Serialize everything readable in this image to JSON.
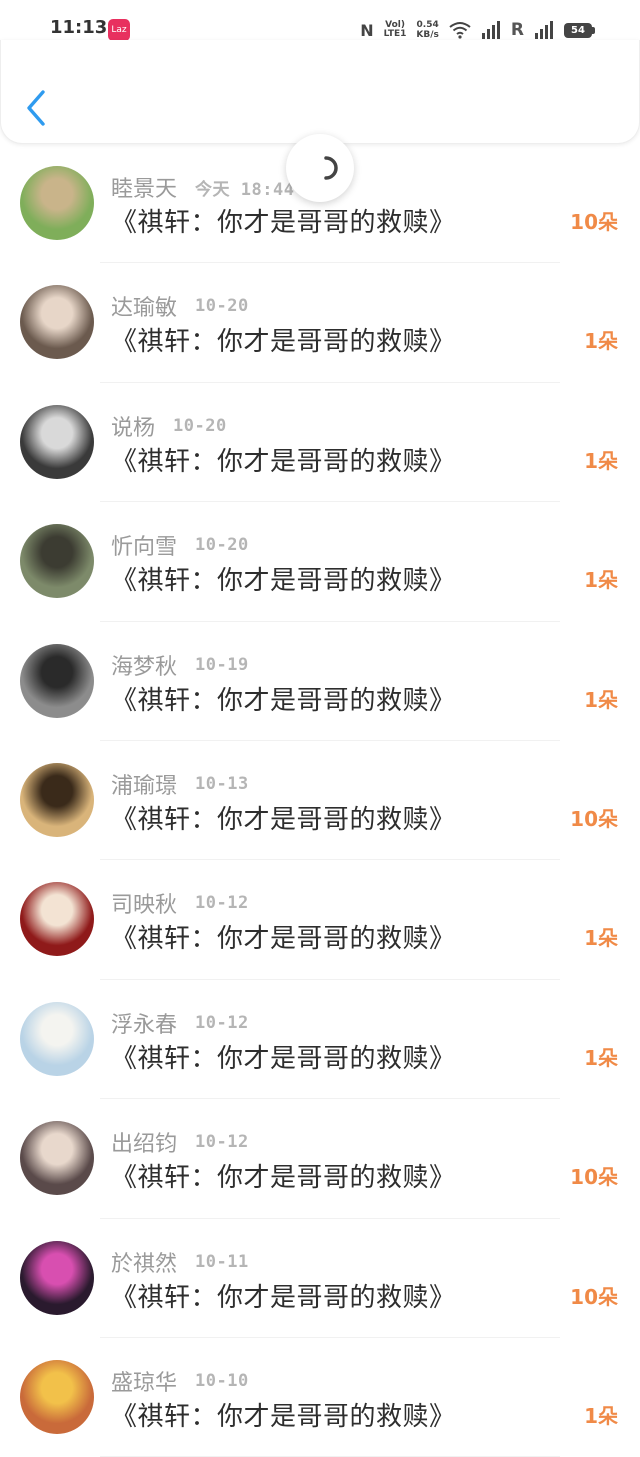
{
  "status_bar": {
    "time": "11:13",
    "app_icon_text": "Laz",
    "nfc": "N",
    "volte_top": "Vol)",
    "volte_bottom": "LTE1",
    "speed_top": "0.54",
    "speed_bottom": "KB/s",
    "roaming": "R",
    "battery": "54"
  },
  "header": {
    "back_icon": "chevron-left-icon"
  },
  "colors": {
    "accent_blue": "#2f9bef",
    "count_orange": "#f08a47",
    "name_gray": "#9a9a9a",
    "date_gray": "#b5b5b5",
    "title_dark": "#2e2e2e"
  },
  "items": [
    {
      "name": "睦景天",
      "date": "今天 18:44",
      "title": "《祺轩：你才是哥哥的救赎》",
      "count": "10朵",
      "avatar_bg": "#7fae5a",
      "avatar_fg": "#c9b48a"
    },
    {
      "name": "达瑜敏",
      "date": "10-20",
      "title": "《祺轩：你才是哥哥的救赎》",
      "count": "1朵",
      "avatar_bg": "#6b5a4e",
      "avatar_fg": "#e7d6c8"
    },
    {
      "name": "说杨",
      "date": "10-20",
      "title": "《祺轩：你才是哥哥的救赎》",
      "count": "1朵",
      "avatar_bg": "#3a3a3a",
      "avatar_fg": "#d9d9d9"
    },
    {
      "name": "忻向雪",
      "date": "10-20",
      "title": "《祺轩：你才是哥哥的救赎》",
      "count": "1朵",
      "avatar_bg": "#7d8a6a",
      "avatar_fg": "#3c3c32"
    },
    {
      "name": "海梦秋",
      "date": "10-19",
      "title": "《祺轩：你才是哥哥的救赎》",
      "count": "1朵",
      "avatar_bg": "#8c8c8c",
      "avatar_fg": "#2a2a2a"
    },
    {
      "name": "浦瑜璟",
      "date": "10-13",
      "title": "《祺轩：你才是哥哥的救赎》",
      "count": "10朵",
      "avatar_bg": "#d9b47a",
      "avatar_fg": "#3a2a1a"
    },
    {
      "name": "司映秋",
      "date": "10-12",
      "title": "《祺轩：你才是哥哥的救赎》",
      "count": "1朵",
      "avatar_bg": "#8f1a1a",
      "avatar_fg": "#f3e3d3"
    },
    {
      "name": "浮永春",
      "date": "10-12",
      "title": "《祺轩：你才是哥哥的救赎》",
      "count": "1朵",
      "avatar_bg": "#b9d3e6",
      "avatar_fg": "#f4f4f0"
    },
    {
      "name": "出绍钧",
      "date": "10-12",
      "title": "《祺轩：你才是哥哥的救赎》",
      "count": "10朵",
      "avatar_bg": "#5a4a4a",
      "avatar_fg": "#e8d8cc"
    },
    {
      "name": "於祺然",
      "date": "10-11",
      "title": "《祺轩：你才是哥哥的救赎》",
      "count": "10朵",
      "avatar_bg": "#2a1a2e",
      "avatar_fg": "#d84fb0"
    },
    {
      "name": "盛琼华",
      "date": "10-10",
      "title": "《祺轩：你才是哥哥的救赎》",
      "count": "1朵",
      "avatar_bg": "#c96a3a",
      "avatar_fg": "#f2c14a"
    }
  ]
}
